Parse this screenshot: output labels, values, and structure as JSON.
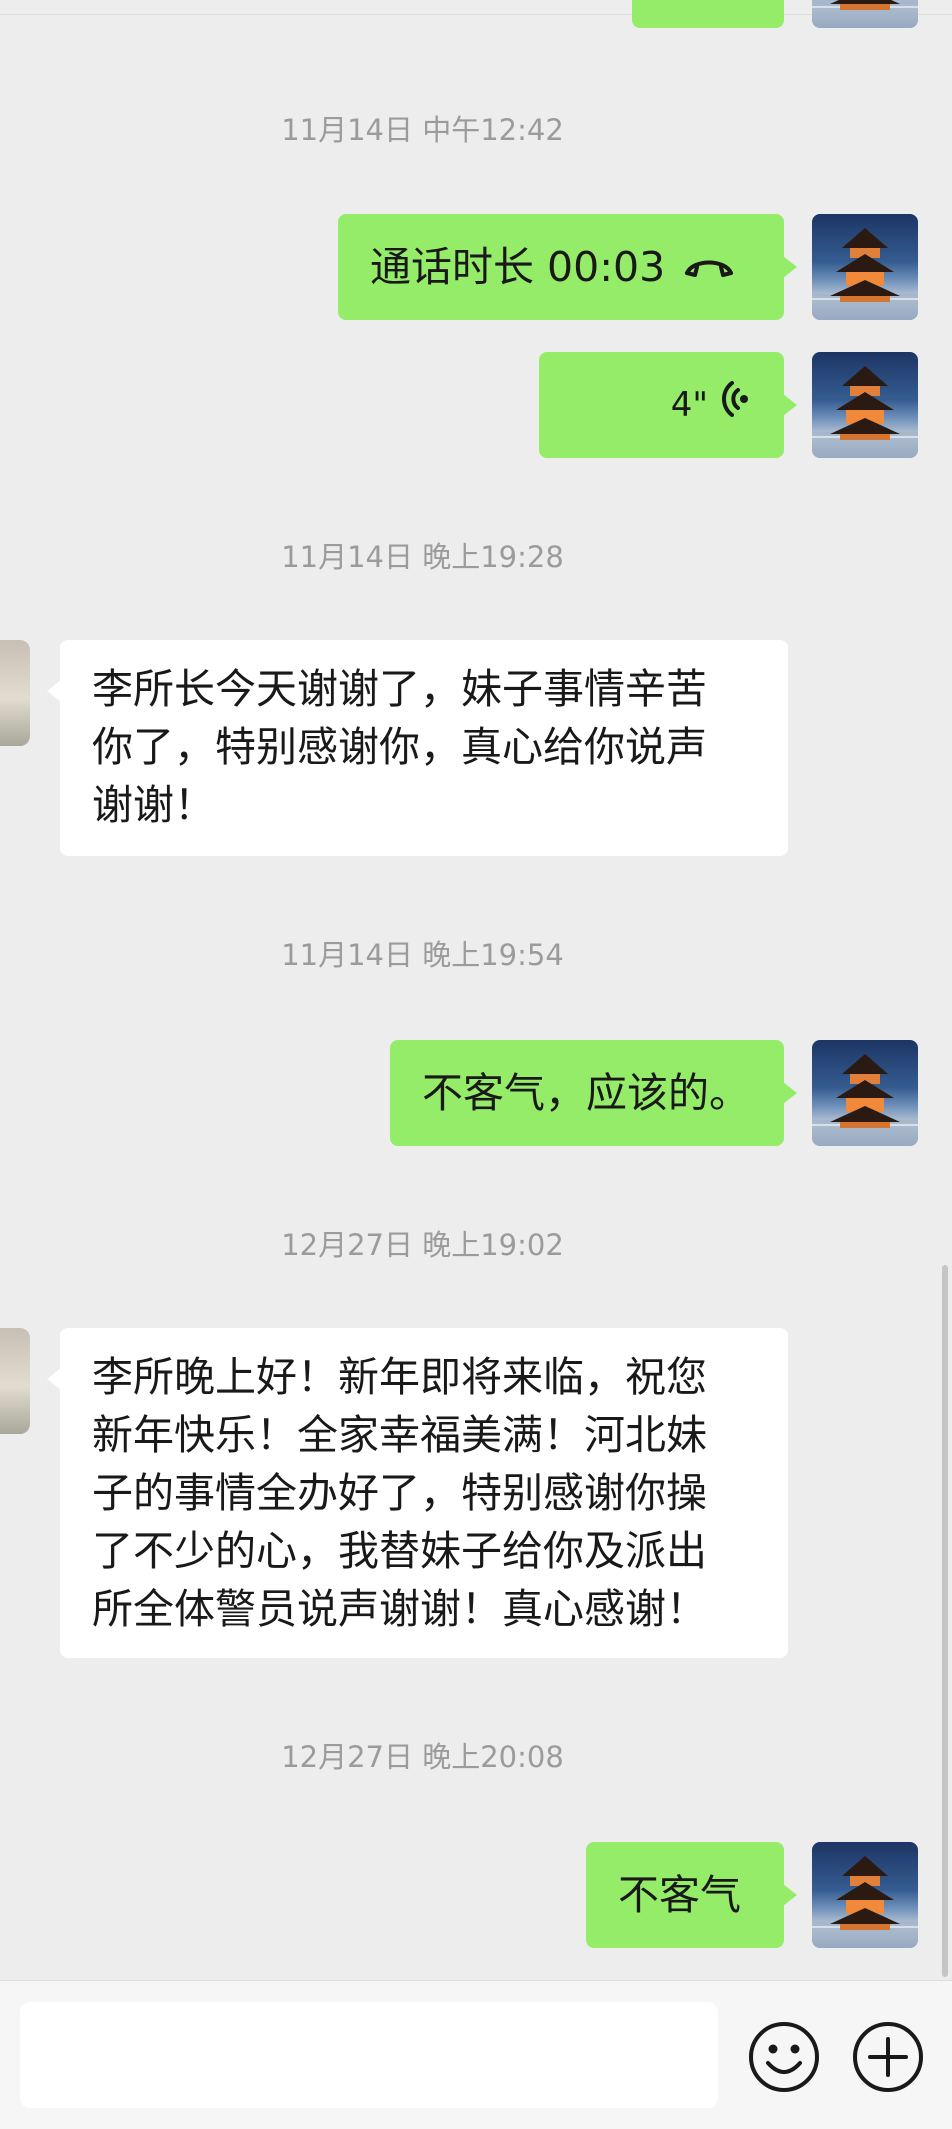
{
  "messages": [
    {
      "type": "timestamp",
      "text": "11月14日 中午12:42"
    },
    {
      "type": "call",
      "direction": "out",
      "label": "通话时长 00:03"
    },
    {
      "type": "voice",
      "direction": "out",
      "duration": "4\""
    },
    {
      "type": "timestamp",
      "text": "11月14日 晚上19:28"
    },
    {
      "type": "text",
      "direction": "in",
      "lines": [
        "李所长今天谢谢了，妹子事情辛苦",
        "你了，特别感谢你，真心给你说声",
        "谢谢！"
      ]
    },
    {
      "type": "timestamp",
      "text": "11月14日 晚上19:54"
    },
    {
      "type": "text",
      "direction": "out",
      "lines": [
        "不客气，应该的。"
      ]
    },
    {
      "type": "timestamp",
      "text": "12月27日 晚上19:02"
    },
    {
      "type": "text",
      "direction": "in",
      "lines": [
        "李所晚上好！新年即将来临，祝您",
        "新年快乐！全家幸福美满！河北妹",
        "子的事情全办好了，特别感谢你操",
        "了不少的心，我替妹子给你及派出",
        "所全体警员说声谢谢！真心感谢！"
      ]
    },
    {
      "type": "timestamp",
      "text": "12月27日 晚上20:08"
    },
    {
      "type": "text",
      "direction": "out",
      "lines": [
        "不客气"
      ]
    }
  ],
  "input_bar": {
    "value": "",
    "emoji_icon": "emoji-icon",
    "plus_icon": "plus-icon"
  },
  "colors": {
    "background": "#ededed",
    "outgoing_bubble": "#95ec69",
    "incoming_bubble": "#ffffff",
    "timestamp": "#9b9b9b"
  }
}
